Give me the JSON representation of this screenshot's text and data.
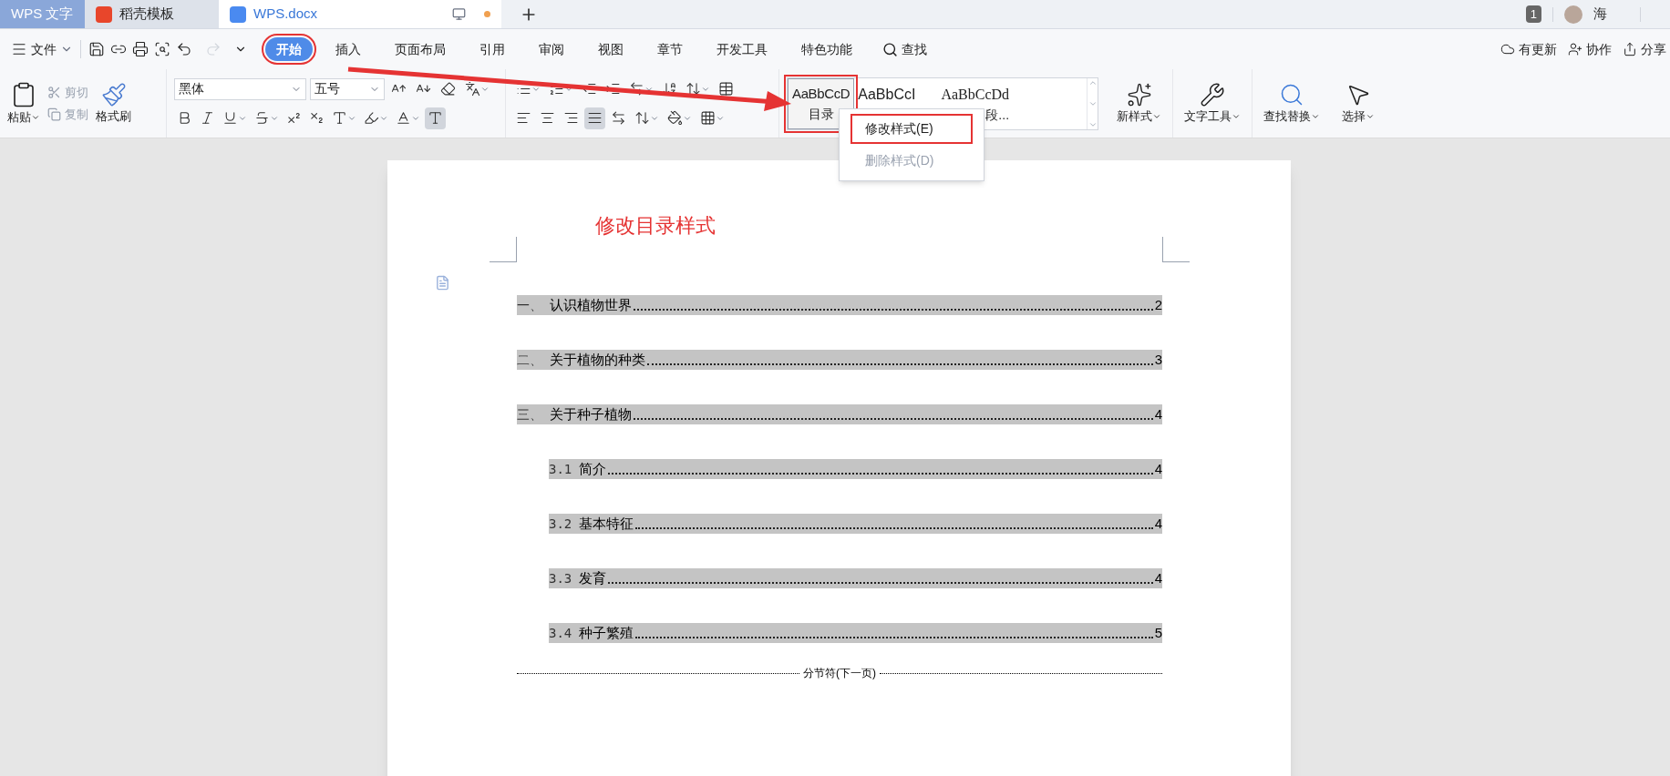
{
  "title_tabs": [
    {
      "kind": "app",
      "label": "WPS 文字",
      "selected": false
    },
    {
      "kind": "template",
      "label": "稻壳模板",
      "selected": false
    },
    {
      "kind": "doc",
      "label": "WPS.docx",
      "selected": true
    }
  ],
  "account": {
    "badge": "1",
    "name": "海"
  },
  "menu": {
    "file": "文件",
    "ribbon_tabs": [
      {
        "label": "开始",
        "selected": true,
        "annotated": true
      },
      {
        "label": "插入",
        "selected": false,
        "annotated": false
      },
      {
        "label": "页面布局",
        "selected": false,
        "annotated": false
      },
      {
        "label": "引用",
        "selected": false,
        "annotated": false
      },
      {
        "label": "审阅",
        "selected": false,
        "annotated": false
      },
      {
        "label": "视图",
        "selected": false,
        "annotated": false
      },
      {
        "label": "章节",
        "selected": false,
        "annotated": false
      },
      {
        "label": "开发工具",
        "selected": false,
        "annotated": false
      },
      {
        "label": "特色功能",
        "selected": false,
        "annotated": false
      }
    ],
    "search": "查找",
    "actions": [
      {
        "kind": "update",
        "label": "有更新"
      },
      {
        "kind": "collab",
        "label": "协作"
      },
      {
        "kind": "share",
        "label": "分享"
      }
    ]
  },
  "ribbon": {
    "paste": "粘贴",
    "cut": {
      "label": "剪切",
      "disabled": true
    },
    "copy": {
      "label": "复制",
      "disabled": true
    },
    "format_painter": "格式刷",
    "font": "黑体",
    "size": "五号",
    "styles": [
      {
        "preview": "AaBbCcD",
        "name": "目录",
        "selected": true,
        "annotated": true
      },
      {
        "preview": "AaBbCcI",
        "selected": false,
        "annotated": false
      },
      {
        "preview": "AaBbCcDd",
        "name": "段...",
        "selected": false,
        "annotated": false
      }
    ],
    "new_style": "新样式",
    "tools": [
      {
        "kind": "wrench",
        "label": "文字工具"
      },
      {
        "kind": "find",
        "label": "查找替换"
      },
      {
        "kind": "select",
        "label": "选择"
      }
    ]
  },
  "context_menu": [
    {
      "label": "修改样式(E)",
      "disabled": false,
      "annotated": true
    },
    {
      "label": "删除样式(D)",
      "disabled": true,
      "annotated": false
    }
  ],
  "annotation_arrow": true,
  "document": {
    "heading": "修改目录样式",
    "toc": [
      {
        "number": "一、",
        "text": "认识植物世界",
        "page": "2"
      },
      {
        "number": "二、",
        "text": "关于植物的种类",
        "page": "3"
      },
      {
        "number": "三、",
        "text": "关于种子植物",
        "page": "4",
        "children": [
          {
            "number": "3.1",
            "text": "简介",
            "page": "4"
          },
          {
            "number": "3.2",
            "text": "基本特征",
            "page": "4"
          },
          {
            "number": "3.3",
            "text": "发育",
            "page": "4"
          },
          {
            "number": "3.4",
            "text": "种子繁殖",
            "page": "5"
          }
        ]
      }
    ],
    "section_break": "分节符(下一页)"
  }
}
